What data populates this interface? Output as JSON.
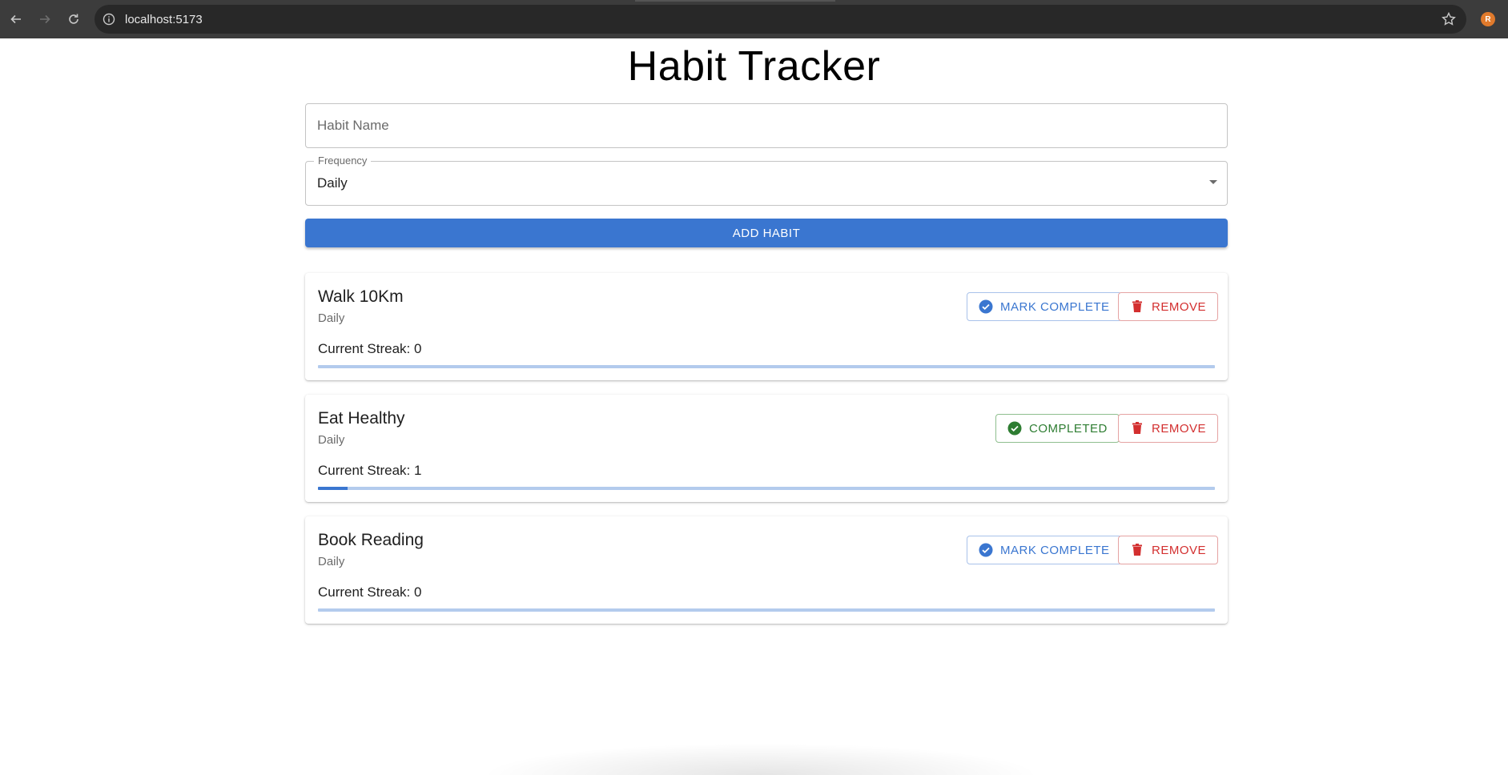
{
  "browser": {
    "url": "localhost:5173",
    "profile_initial": "R",
    "icons": {
      "back": "arrow-left-icon",
      "forward": "arrow-right-icon",
      "reload": "reload-icon",
      "info": "info-icon",
      "bookmark": "star-icon"
    }
  },
  "app": {
    "title": "Habit Tracker",
    "habit_name_placeholder": "Habit Name",
    "frequency_label": "Frequency",
    "frequency_value": "Daily",
    "add_button_label": "ADD HABIT"
  },
  "colors": {
    "primary": "#3a76d0",
    "success": "#2e7d32",
    "error": "#d32f2f"
  },
  "habits": [
    {
      "name": "Walk 10Km",
      "frequency": "Daily",
      "streak_text": "Current Streak: 0",
      "status_label": "MARK COMPLETE",
      "status": "pending",
      "remove_label": "REMOVE",
      "progress": 0
    },
    {
      "name": "Eat Healthy",
      "frequency": "Daily",
      "streak_text": "Current Streak: 1",
      "status_label": "COMPLETED",
      "status": "completed",
      "remove_label": "REMOVE",
      "progress": 0.033
    },
    {
      "name": "Book Reading",
      "frequency": "Daily",
      "streak_text": "Current Streak: 0",
      "status_label": "MARK COMPLETE",
      "status": "pending",
      "remove_label": "REMOVE",
      "progress": 0
    }
  ]
}
